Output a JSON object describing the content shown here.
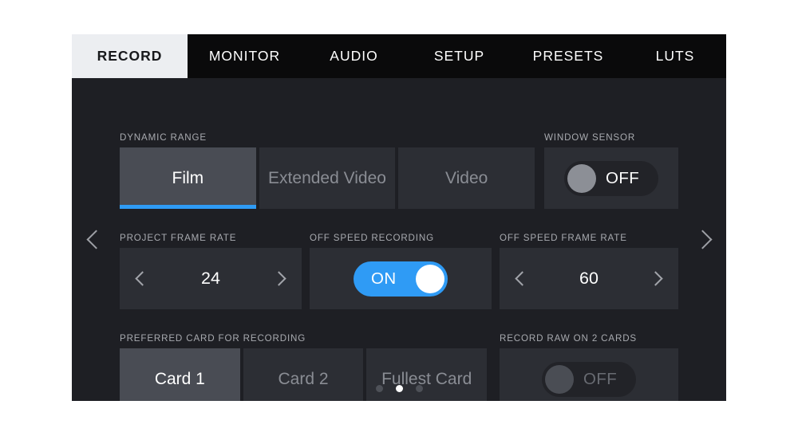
{
  "device": {
    "accent_color": "#2f9bf5",
    "panel_bg": "#1e1f24",
    "tabbar_bg": "#0a0a0b"
  },
  "tabs": [
    {
      "label": "RECORD",
      "active": true
    },
    {
      "label": "MONITOR",
      "active": false
    },
    {
      "label": "AUDIO",
      "active": false
    },
    {
      "label": "SETUP",
      "active": false
    },
    {
      "label": "PRESETS",
      "active": false
    },
    {
      "label": "LUTS",
      "active": false
    }
  ],
  "nav": {
    "prev_icon": "chevron-left-icon",
    "next_icon": "chevron-right-icon"
  },
  "fields": {
    "dynamic_range": {
      "label": "DYNAMIC RANGE",
      "options": [
        "Film",
        "Extended Video",
        "Video"
      ],
      "selected": "Film",
      "selected_index": 0
    },
    "window_sensor": {
      "label": "WINDOW SENSOR",
      "state": "OFF",
      "on": false,
      "disabled": false
    },
    "project_frame_rate": {
      "label": "PROJECT FRAME RATE",
      "value": "24",
      "prev_icon": "chevron-left-icon",
      "next_icon": "chevron-right-icon"
    },
    "off_speed_recording": {
      "label": "OFF SPEED RECORDING",
      "state": "ON",
      "on": true,
      "disabled": false
    },
    "off_speed_frame_rate": {
      "label": "OFF SPEED FRAME RATE",
      "value": "60",
      "prev_icon": "chevron-left-icon",
      "next_icon": "chevron-right-icon"
    },
    "preferred_card": {
      "label": "PREFERRED CARD FOR RECORDING",
      "options": [
        "Card 1",
        "Card 2",
        "Fullest Card"
      ],
      "selected": "Card 1",
      "selected_index": 0
    },
    "record_raw_2_cards": {
      "label": "RECORD RAW ON 2 CARDS",
      "state": "OFF",
      "on": false,
      "disabled": true
    }
  },
  "pager": {
    "total": 3,
    "current": 2
  }
}
